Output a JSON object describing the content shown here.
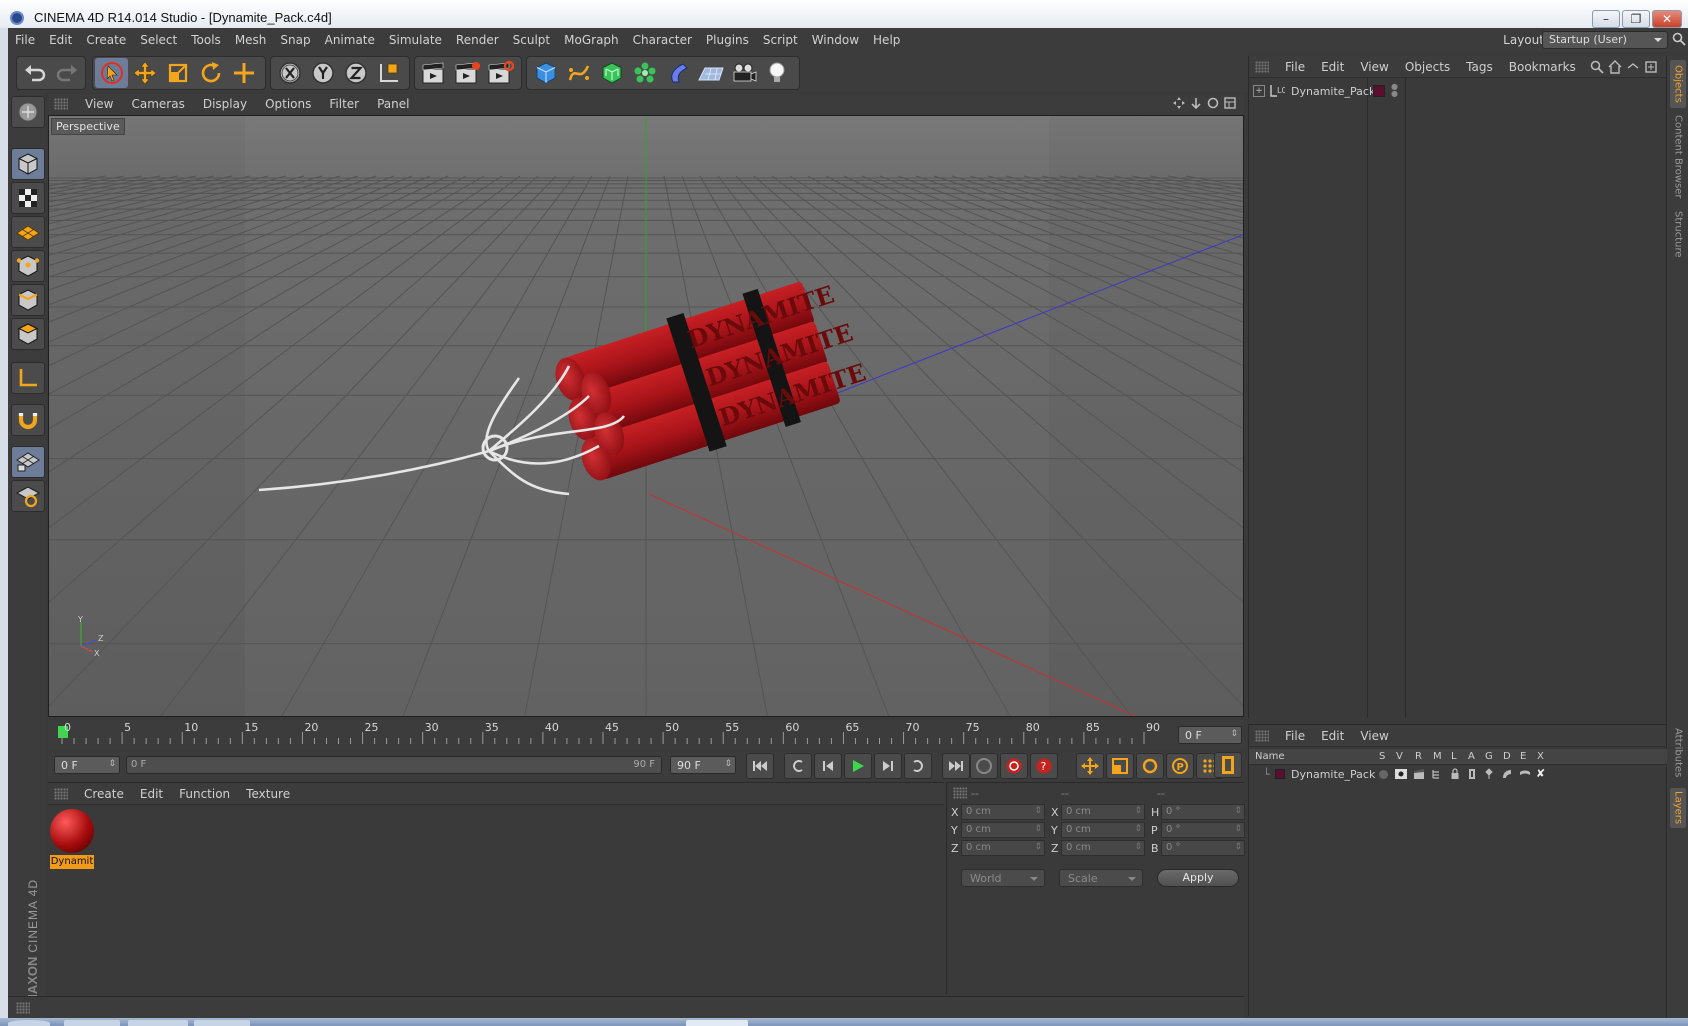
{
  "window": {
    "title": "CINEMA 4D R14.014 Studio - [Dynamite_Pack.c4d]",
    "minimize": "–",
    "restore": "❐",
    "close": "✕"
  },
  "menubar": {
    "items": [
      "File",
      "Edit",
      "Create",
      "Select",
      "Tools",
      "Mesh",
      "Snap",
      "Animate",
      "Simulate",
      "Render",
      "Sculpt",
      "MoGraph",
      "Character",
      "Plugins",
      "Script",
      "Window",
      "Help"
    ],
    "layout_label": "Layout:",
    "layout_value": "Startup (User)"
  },
  "viewport": {
    "menu": [
      "View",
      "Cameras",
      "Display",
      "Options",
      "Filter",
      "Panel"
    ],
    "label": "Perspective",
    "axis_y": "Y",
    "axis_z": "Z",
    "axis_x": "X",
    "stick_text": "DYNAMITE"
  },
  "timeline": {
    "ticks": [
      "0",
      "5",
      "10",
      "15",
      "20",
      "25",
      "30",
      "35",
      "40",
      "45",
      "50",
      "55",
      "60",
      "65",
      "70",
      "75",
      "80",
      "85",
      "90"
    ],
    "current_frame": "0 F",
    "start_frame": "0 F",
    "range_start": "0 F",
    "range_end": "90 F",
    "end_frame": "90 F"
  },
  "material_manager": {
    "menu": [
      "Create",
      "Edit",
      "Function",
      "Texture"
    ],
    "materials": [
      {
        "name": "Dynamit"
      }
    ]
  },
  "coordinates": {
    "headers": [
      "--",
      "--",
      "--"
    ],
    "rows": [
      {
        "a1": "X",
        "v1": "0 cm",
        "a2": "X",
        "v2": "0 cm",
        "a3": "H",
        "v3": "0 °"
      },
      {
        "a1": "Y",
        "v1": "0 cm",
        "a2": "Y",
        "v2": "0 cm",
        "a3": "P",
        "v3": "0 °"
      },
      {
        "a1": "Z",
        "v1": "0 cm",
        "a2": "Z",
        "v2": "0 cm",
        "a3": "B",
        "v3": "0 °"
      }
    ],
    "space": "World",
    "mode": "Scale",
    "apply_label": "Apply"
  },
  "object_manager": {
    "menu": [
      "File",
      "Edit",
      "View",
      "Objects",
      "Tags",
      "Bookmarks"
    ],
    "objects": [
      {
        "name": "Dynamite_Pack",
        "tag": "L0"
      }
    ]
  },
  "layer_manager": {
    "menu": [
      "File",
      "Edit",
      "View"
    ],
    "columns": [
      "Name",
      "S",
      "V",
      "R",
      "M",
      "L",
      "A",
      "G",
      "D",
      "E",
      "X"
    ],
    "layers": [
      {
        "name": "Dynamite_Pack",
        "color": "#5a0f2e"
      }
    ]
  },
  "side_tabs": [
    "Objects",
    "Content Browser",
    "Structure",
    "Attributes",
    "Layers"
  ],
  "branding": {
    "maxon": "MAXON",
    "product": "CINEMA 4D"
  },
  "colors": {
    "accent": "#f29a1a",
    "dynamite_red": "#b5161a",
    "active_tool": "#6d7c98"
  }
}
